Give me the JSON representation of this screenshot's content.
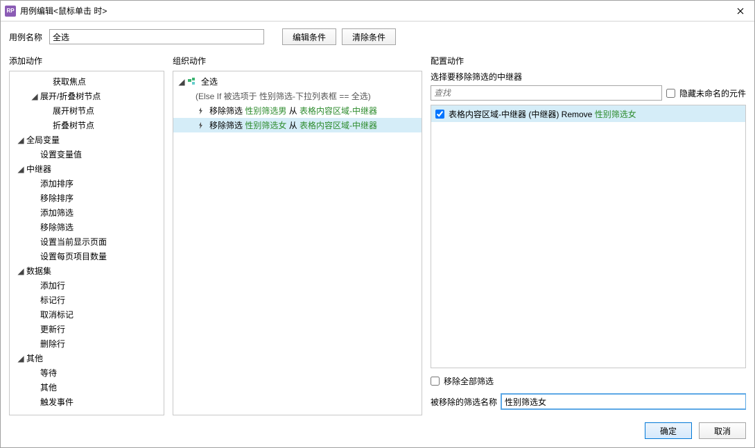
{
  "titlebar": {
    "title": "用例编辑<鼠标单击 时>"
  },
  "top": {
    "case_name_label": "用例名称",
    "case_name_value": "全选",
    "edit_condition": "编辑条件",
    "clear_condition": "清除条件"
  },
  "left": {
    "title": "添加动作",
    "items": [
      {
        "label": "获取焦点",
        "level": 2
      },
      {
        "label": "展开/折叠树节点",
        "level": 1,
        "caret": true
      },
      {
        "label": "展开树节点",
        "level": 2
      },
      {
        "label": "折叠树节点",
        "level": 2
      },
      {
        "label": "全局变量",
        "level": 0,
        "caret": true
      },
      {
        "label": "设置变量值",
        "level": 1
      },
      {
        "label": "中继器",
        "level": 0,
        "caret": true
      },
      {
        "label": "添加排序",
        "level": 1
      },
      {
        "label": "移除排序",
        "level": 1
      },
      {
        "label": "添加筛选",
        "level": 1
      },
      {
        "label": "移除筛选",
        "level": 1
      },
      {
        "label": "设置当前显示页面",
        "level": 1
      },
      {
        "label": "设置每页项目数量",
        "level": 1
      },
      {
        "label": "数据集",
        "level": 0,
        "caret": true
      },
      {
        "label": "添加行",
        "level": 1
      },
      {
        "label": "标记行",
        "level": 1
      },
      {
        "label": "取消标记",
        "level": 1
      },
      {
        "label": "更新行",
        "level": 1
      },
      {
        "label": "删除行",
        "level": 1
      },
      {
        "label": "其他",
        "level": 0,
        "caret": true
      },
      {
        "label": "等待",
        "level": 1
      },
      {
        "label": "其他",
        "level": 1
      },
      {
        "label": "触发事件",
        "level": 1
      }
    ]
  },
  "middle": {
    "title": "组织动作",
    "case_label": "全选",
    "condition": "(Else If 被选项于 性别筛选-下拉列表框 == 全选)",
    "actions": [
      {
        "prefix": "移除筛选",
        "param": "性别筛选男",
        "mid": "从",
        "target": "表格内容区域-中继器",
        "selected": false
      },
      {
        "prefix": "移除筛选",
        "param": "性别筛选女",
        "mid": "从",
        "target": "表格内容区域-中继器",
        "selected": true
      }
    ]
  },
  "right": {
    "title": "配置动作",
    "select_label": "选择要移除筛选的中继器",
    "search_placeholder": "查找",
    "hide_unnamed": "隐藏未命名的元件",
    "repeater_item": {
      "name": "表格内容区域-中继器 (中继器) Remove",
      "suffix": "性别筛选女"
    },
    "remove_all": "移除全部筛选",
    "filter_name_label": "被移除的筛选名称",
    "filter_name_value": "性别筛选女"
  },
  "footer": {
    "ok": "确定",
    "cancel": "取消"
  }
}
